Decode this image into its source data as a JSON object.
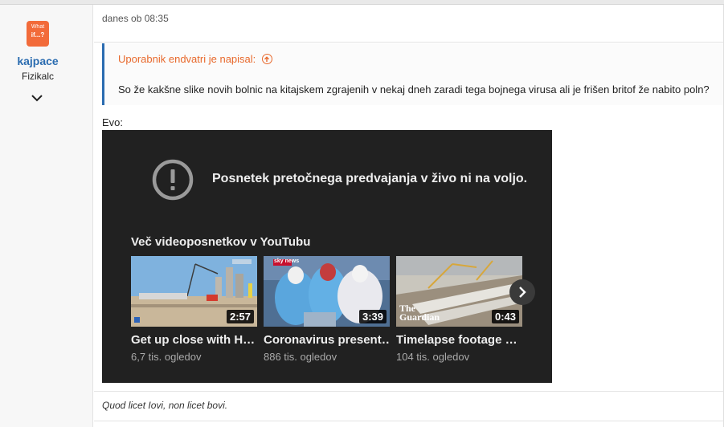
{
  "user": {
    "avatar_line1": "What",
    "avatar_line2": "if...?",
    "name": "kajpace",
    "rank": "Fizikalc"
  },
  "post": {
    "date": "danes ob 08:35",
    "quote_author": "Uporabnik endvatri je napisal:",
    "quote_text": "So že kakšne slike novih bolnic na kitajskem zgrajenih v nekaj dneh zaradi tega bojnega virusa ali je frišen britof že nabito poln?",
    "body_text": "Evo:",
    "signature": "Quod licet Iovi, non licet bovi."
  },
  "embed": {
    "unavailable_text": "Posnetek pretočnega predvajanja v živo ni na voljo.",
    "more_videos_title": "Več videoposnetkov v YouTubu",
    "videos": [
      {
        "title": "Get up close with H…",
        "views": "6,7 tis. ogledov",
        "duration": "2:57",
        "thumb_badge": ""
      },
      {
        "title": "Coronavirus present…",
        "views": "886 tis. ogledov",
        "duration": "3:39",
        "thumb_badge": "sky news"
      },
      {
        "title": "Timelapse footage …",
        "views": "104 tis. ogledov",
        "duration": "0:43",
        "thumb_badge": "The Guardian"
      }
    ]
  },
  "colors": {
    "link_blue": "#2b6cb0",
    "quote_orange": "#e8692c",
    "avatar_orange": "#f26b3a",
    "embed_bg": "#212121"
  },
  "icons": {
    "expand": "chevron-down-icon",
    "quote_jump": "arrow-up-circle-icon",
    "alert": "exclamation-circle-icon",
    "next": "chevron-right-icon"
  }
}
